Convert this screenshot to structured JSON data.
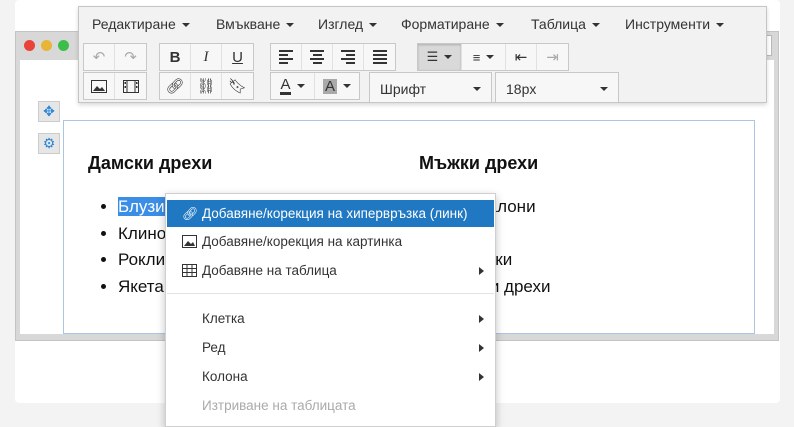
{
  "menubar": [
    {
      "label": "Редактиране"
    },
    {
      "label": "Вмъкване"
    },
    {
      "label": "Изглед"
    },
    {
      "label": "Форматиране"
    },
    {
      "label": "Таблица"
    },
    {
      "label": "Инструменти"
    }
  ],
  "toolbar": {
    "font_select": "Шрифт",
    "size_select": "18px",
    "text_color_letter": "A",
    "bg_color_letter": "A"
  },
  "window": {
    "close_glyph": "✕"
  },
  "content": {
    "left": {
      "heading": "Дамски дрехи",
      "items": [
        "Блузи",
        "Клинове",
        "Рокли",
        "Якета"
      ]
    },
    "right": {
      "heading": "Мъжки дрехи",
      "items": [
        "Панталони",
        "",
        "Тениски",
        "Зимни дрехи"
      ]
    }
  },
  "context_menu": {
    "items": [
      {
        "label": "Добавяне/корекция на хипервръзка (линк)",
        "icon": "link-icon",
        "state": "highlighted"
      },
      {
        "label": "Добавяне/корекция на картинка",
        "icon": "image-icon"
      },
      {
        "label": "Добавяне на таблица",
        "icon": "table-icon",
        "submenu": true
      },
      {
        "label": "Клетка",
        "submenu": true
      },
      {
        "label": "Ред",
        "submenu": true
      },
      {
        "label": "Колона",
        "submenu": true
      },
      {
        "label": "Изтриване на таблицата",
        "state": "disabled"
      }
    ]
  },
  "colors": {
    "highlight": "#1f78c1",
    "selection": "#3a8ee6",
    "frame_border": "#a9c7e3"
  }
}
